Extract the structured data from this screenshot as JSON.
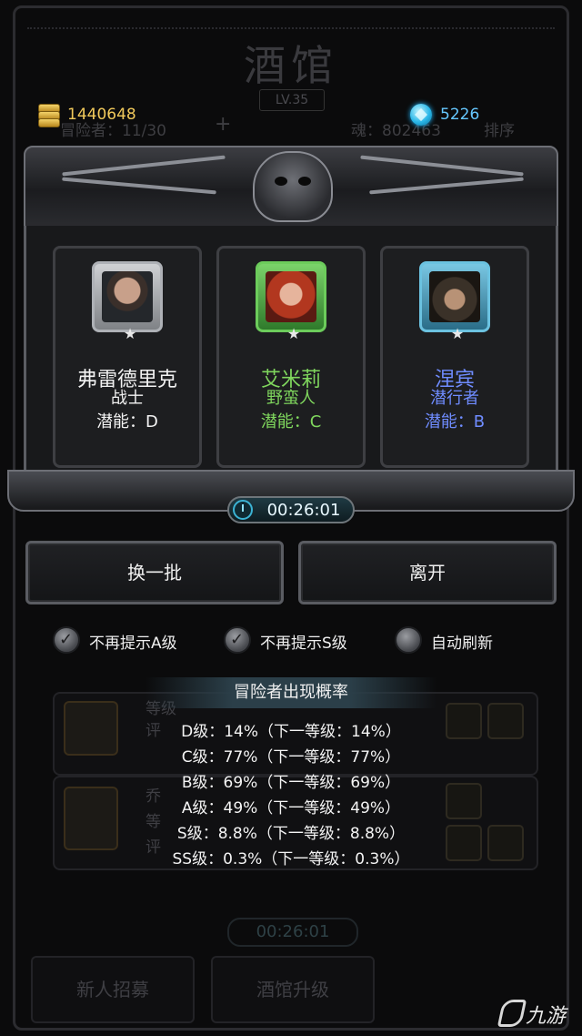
{
  "background": {
    "title": "酒馆",
    "level": "LV.35",
    "adventurers_label": "冒险者：11/30",
    "plus": "+",
    "soul_label": "魂：802463",
    "sort_label": "排序",
    "row1_text": [
      "等级",
      "评"
    ],
    "row2_text": [
      "乔",
      "等",
      "评"
    ],
    "timer": "00:26:01",
    "buttons": [
      "新人招募",
      "酒馆升级"
    ]
  },
  "currency": {
    "gold": "1440648",
    "gems": "5226"
  },
  "recruits": [
    {
      "name": "弗雷德里克",
      "class": "战士",
      "potential": "潜能：D",
      "name_color": "#f2f2f2",
      "portrait_icon": "male-warrior-portrait"
    },
    {
      "name": "艾米莉",
      "class": "野蛮人",
      "potential": "潜能：C",
      "name_color": "#7fd65d",
      "portrait_icon": "red-haired-woman-portrait"
    },
    {
      "name": "涅宾",
      "class": "潜行者",
      "potential": "潜能：B",
      "name_color": "#6f8cff",
      "portrait_icon": "hooded-rogue-portrait"
    }
  ],
  "star_glyph": "★",
  "timer": "00:26:01",
  "buttons": {
    "refresh": "换一批",
    "leave": "离开"
  },
  "options": [
    {
      "label": "不再提示A级",
      "checked": true
    },
    {
      "label": "不再提示S级",
      "checked": true
    },
    {
      "label": "自动刷新",
      "checked": false
    }
  ],
  "probability": {
    "title": "冒险者出现概率",
    "lines": [
      "D级：14%（下一等级：14%）",
      "C级：77%（下一等级：77%）",
      "B级：69%（下一等级：69%）",
      "A级：49%（下一等级：49%）",
      "S级：8.8%（下一等级：8.8%）",
      "SS级：0.3%（下一等级：0.3%）"
    ]
  },
  "watermark": "九游"
}
